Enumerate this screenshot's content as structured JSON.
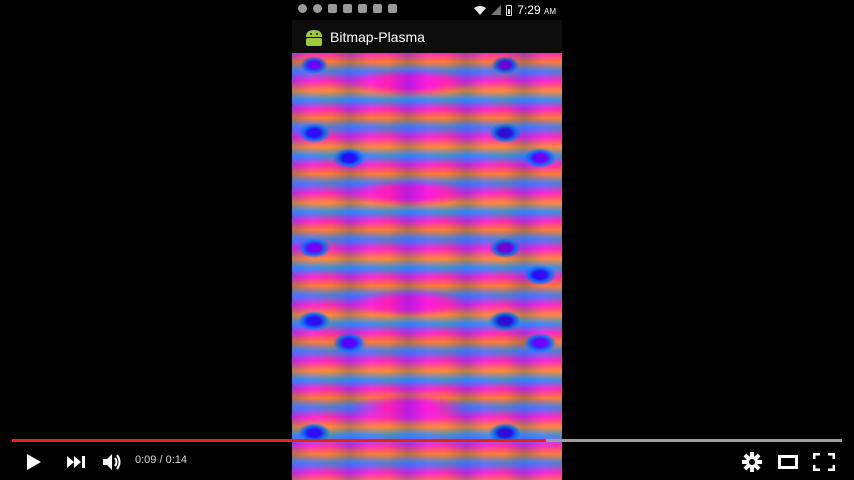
{
  "app": {
    "title": "Bitmap-Plasma",
    "status_time": "7:29",
    "status_ampm": "AM"
  },
  "player": {
    "current_time": "0:09",
    "separator": " / ",
    "duration": "0:14",
    "progress_fraction": 0.6428,
    "colors": {
      "progress_played": "#e62117",
      "progress_unplayed": "#9e9e9e",
      "icons": "#ffffff"
    },
    "icons": {
      "play": "play-icon",
      "next": "next-icon",
      "volume": "volume-icon",
      "settings": "gear-icon",
      "theater": "theater-mode-icon",
      "fullscreen": "fullscreen-icon"
    }
  }
}
